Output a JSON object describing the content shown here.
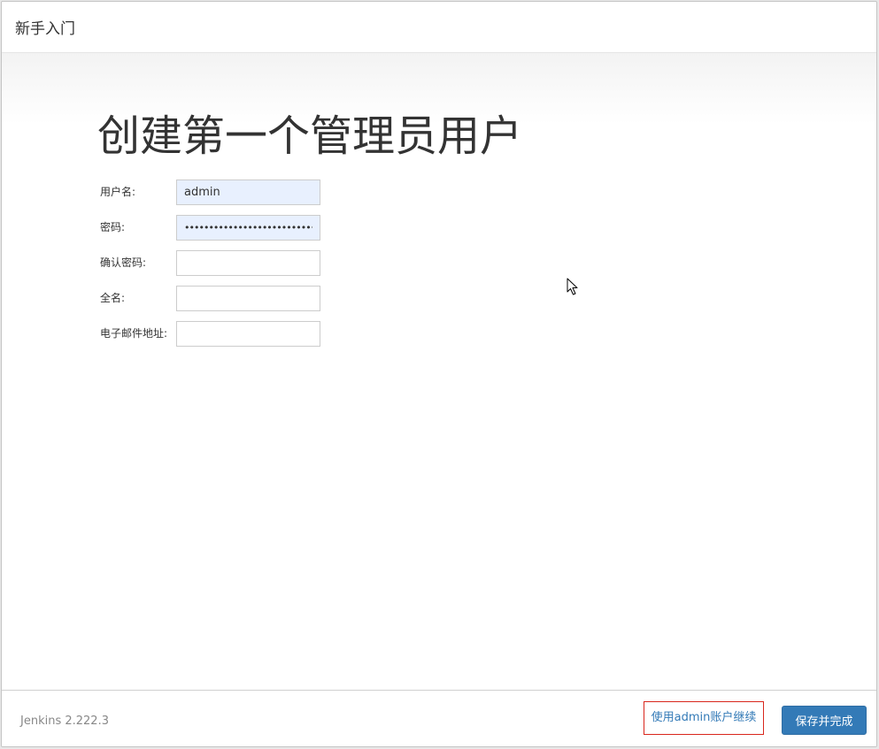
{
  "header": {
    "title": "新手入门"
  },
  "main": {
    "title": "创建第一个管理员用户",
    "fields": [
      {
        "label": "用户名:",
        "value": "admin"
      },
      {
        "label": "密码:",
        "value": "••••••••••••••••••••••••••••••••"
      },
      {
        "label": "确认密码:",
        "value": ""
      },
      {
        "label": "全名:",
        "value": ""
      },
      {
        "label": "电子邮件地址:",
        "value": ""
      }
    ]
  },
  "footer": {
    "version": "Jenkins 2.222.3",
    "continue_label": "使用admin账户继续",
    "save_label": "保存并完成"
  },
  "colors": {
    "primary": "#337ab7",
    "highlight_border": "#d9261c",
    "autofill_bg": "#e8f0fe"
  },
  "icons": {
    "cursor": "mouse-pointer-icon"
  }
}
